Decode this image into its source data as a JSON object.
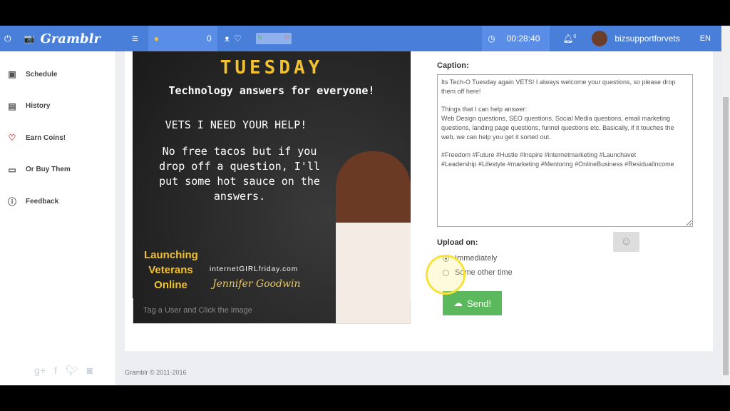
{
  "header": {
    "app_name": "Gramblr",
    "coins": "0",
    "toggle_on": "N",
    "toggle_off": "O",
    "timer": "00:28:40",
    "notifications": "0",
    "username": "bizsupportforvets",
    "language": "EN"
  },
  "sidebar": {
    "items": [
      {
        "label": "Schedule",
        "icon": "calendar-icon"
      },
      {
        "label": "History",
        "icon": "book-icon"
      },
      {
        "label": "Earn Coins!",
        "icon": "heart-icon"
      },
      {
        "label": "Or Buy Them",
        "icon": "card-icon"
      },
      {
        "label": "Feedback",
        "icon": "question-icon"
      }
    ]
  },
  "post_image": {
    "title": "TUESDAY",
    "subtitle": "Technology answers for everyone!",
    "line1": "VETS I NEED YOUR HELP!",
    "line2": "No free tacos but if you drop off a question, I'll put some hot sauce on the answers.",
    "brand": "Launching Veterans Online",
    "site": "internetGIRLfriday.com",
    "signature": "Jennifer Goodwin"
  },
  "tag_hint": "Tag a User and Click the image",
  "caption": {
    "label": "Caption:",
    "text": "Its Tech-O Tuesday again VETS! I always welcome your questions, so please drop them off here!\n\nThings that I can help answer:\nWeb Design questions, SEO questions, Social Media questions, email marketing questions, landing page questions, funnel questions etc. Basically, if it touches the web, we can help you get it sorted out.\n\n#Freedom #Future #Hustle #Inspire #internetmarketing #Launchavet\n#Leadership #Lifestyle #marketing #Mentoring #OnlineBusiness #ResidualIncome"
  },
  "upload": {
    "label": "Upload on:",
    "options": [
      "Immediately",
      "Some other time"
    ],
    "selected": "Immediately"
  },
  "send_label": "Send!",
  "footer": "Gramblr © 2011-2016",
  "colors": {
    "header": "#4a7fd9",
    "send": "#5cb85c"
  }
}
